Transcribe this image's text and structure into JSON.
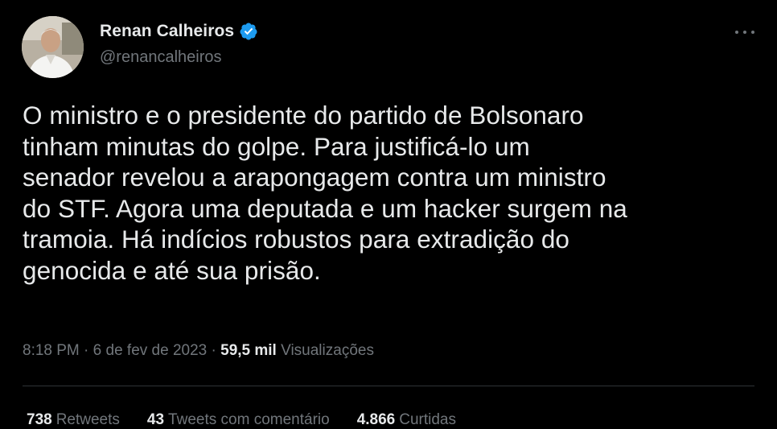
{
  "author": {
    "display_name": "Renan Calheiros",
    "handle": "@renancalheiros",
    "verified": true
  },
  "tweet": {
    "text": "O ministro e o presidente do partido de Bolsonaro\ntinham minutas do golpe. Para justificá-lo um\nsenador revelou a arapongagem contra um ministro\ndo STF. Agora uma deputada e um hacker surgem na\ntramoia. Há indícios robustos para extradição do\ngenocida e até sua prisão.",
    "time": "8:18 PM",
    "separator": "·",
    "date": "6 de fev de 2023",
    "views_count": "59,5 mil",
    "views_label": "Visualizações"
  },
  "stats": {
    "retweets_count": "738",
    "retweets_label": "Retweets",
    "quotes_count": "43",
    "quotes_label": "Tweets com comentário",
    "likes_count": "4.866",
    "likes_label": "Curtidas"
  },
  "icons": {
    "verified": "verified-badge-icon",
    "more": "more-options-icon"
  },
  "colors": {
    "background": "#000000",
    "text_primary": "#e7e9ea",
    "text_secondary": "#71767b",
    "verified_blue": "#1d9bf0",
    "divider": "#2f3336"
  }
}
